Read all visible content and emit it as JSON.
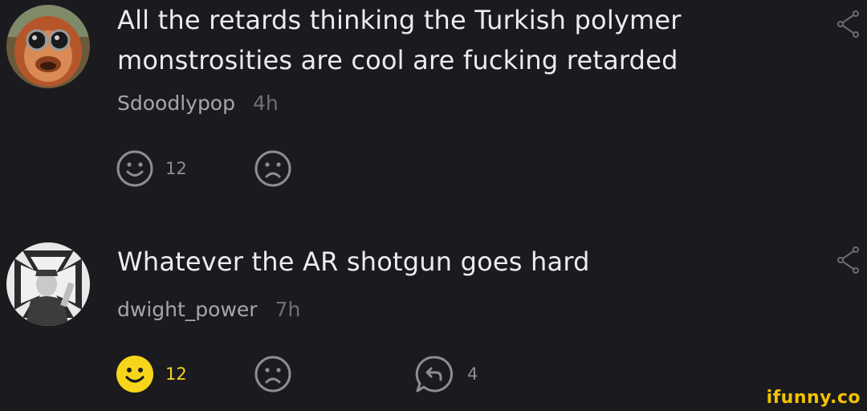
{
  "comments": [
    {
      "text_line1": "All the retards thinking the Turkish polymer",
      "text_line2": "monstrosities are cool are fucking retarded",
      "username": "Sdoodlypop",
      "time": "4h",
      "smile_count": "12",
      "avatar": "orangutan-with-goggles",
      "smile_active": false
    },
    {
      "text_line1": "Whatever the AR shotgun goes hard",
      "username": "dwight_power",
      "time": "7h",
      "smile_count": "12",
      "reply_count": "4",
      "avatar": "bw-portrait-iron-cross",
      "smile_active": true
    }
  ],
  "icons": {
    "smile": "smile-icon",
    "frown": "frown-icon",
    "reply": "reply-icon",
    "share": "share-icon"
  },
  "colors": {
    "background": "#1b1b1f",
    "text": "#ececef",
    "meta": "#a6a6ad",
    "time": "#6f6f77",
    "icon": "#8d8d94",
    "active_smile": "#f7d51b"
  },
  "watermark": "ifunny.co"
}
